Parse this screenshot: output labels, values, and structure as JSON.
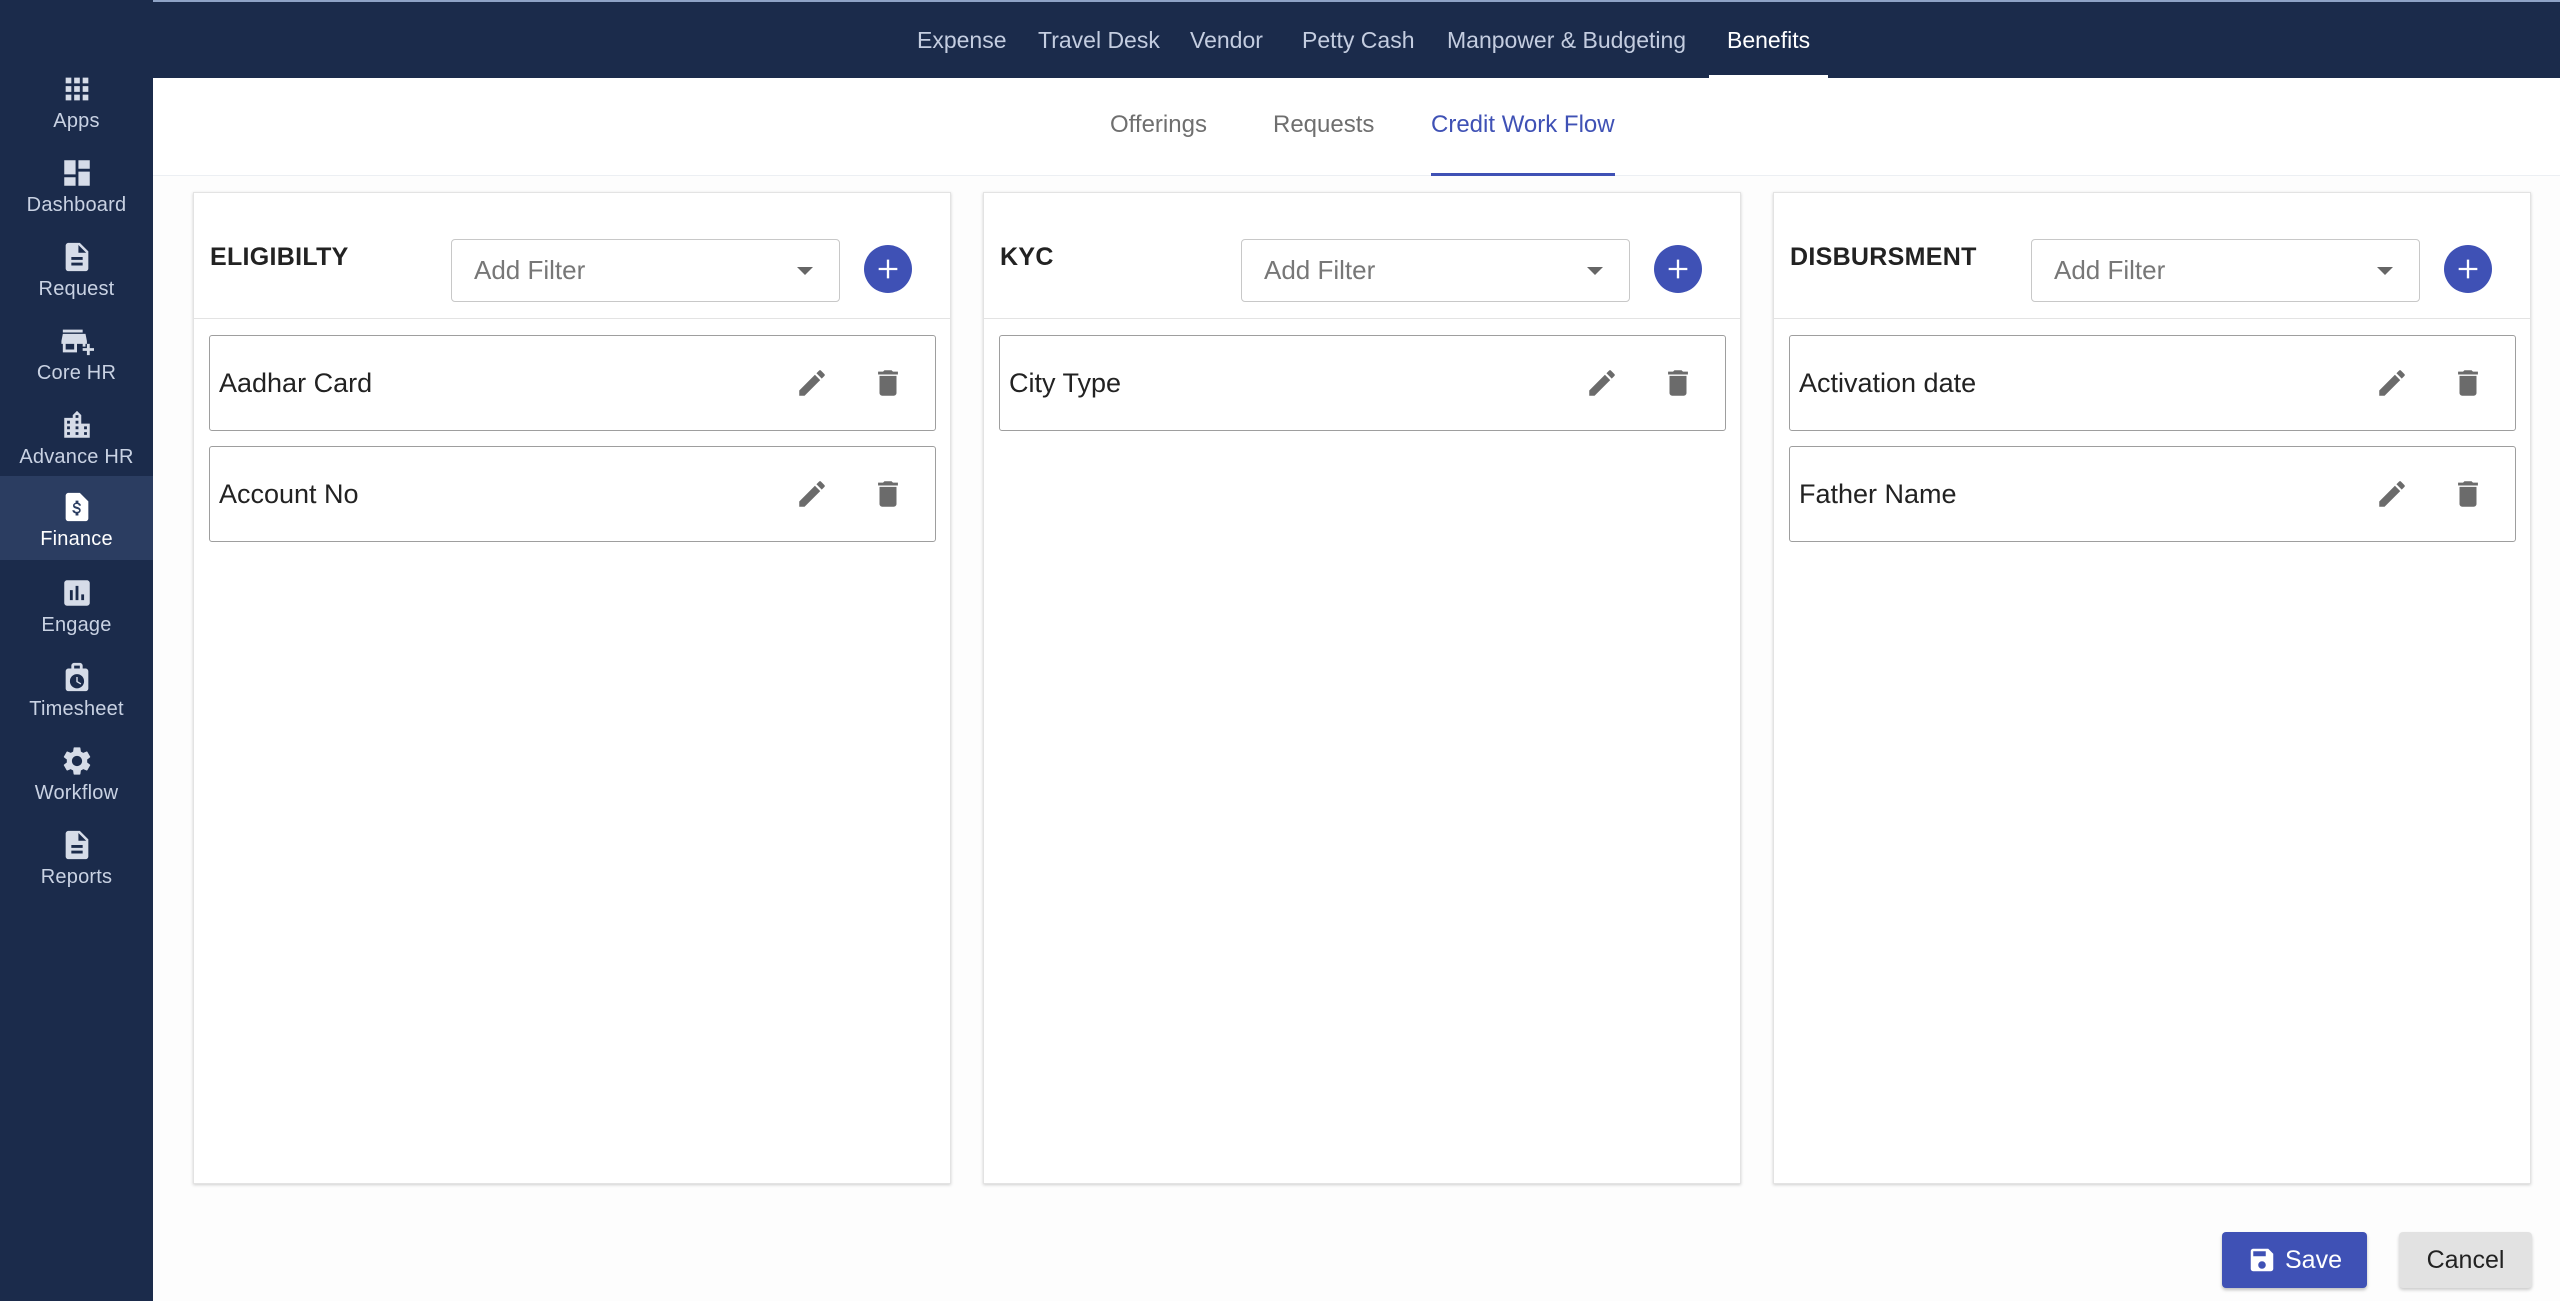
{
  "top_nav": {
    "items": [
      {
        "label": "Expense"
      },
      {
        "label": "Travel Desk"
      },
      {
        "label": "Vendor"
      },
      {
        "label": "Petty Cash"
      },
      {
        "label": "Manpower & Budgeting"
      },
      {
        "label": "Benefits",
        "active": true
      }
    ]
  },
  "sidebar": {
    "items": [
      {
        "label": "Apps",
        "icon": "apps-grid-icon"
      },
      {
        "label": "Dashboard",
        "icon": "dashboard-icon"
      },
      {
        "label": "Request",
        "icon": "document-icon"
      },
      {
        "label": "Core HR",
        "icon": "store-add-icon"
      },
      {
        "label": "Advance HR",
        "icon": "building-icon"
      },
      {
        "label": "Finance",
        "icon": "finance-dollar-icon",
        "active": true
      },
      {
        "label": "Engage",
        "icon": "bar-chart-icon"
      },
      {
        "label": "Timesheet",
        "icon": "clock-bag-icon"
      },
      {
        "label": "Workflow",
        "icon": "gear-icon"
      },
      {
        "label": "Reports",
        "icon": "report-document-icon"
      }
    ]
  },
  "sub_tabs": {
    "items": [
      {
        "label": "Offerings"
      },
      {
        "label": "Requests"
      },
      {
        "label": "Credit Work Flow",
        "active": true
      }
    ]
  },
  "panels": [
    {
      "title": "ELIGIBILTY",
      "filter_placeholder": "Add Filter",
      "fields": [
        {
          "name": "Aadhar Card"
        },
        {
          "name": "Account No"
        }
      ]
    },
    {
      "title": "KYC",
      "filter_placeholder": "Add Filter",
      "fields": [
        {
          "name": "City Type"
        }
      ]
    },
    {
      "title": "DISBURSMENT",
      "filter_placeholder": "Add Filter",
      "fields": [
        {
          "name": "Activation date"
        },
        {
          "name": "Father Name"
        }
      ]
    }
  ],
  "actions": {
    "save_label": "Save",
    "cancel_label": "Cancel"
  },
  "colors": {
    "nav_background": "#1b2b4b",
    "accent": "#3f51b5",
    "cancel_background": "#e2e2e2"
  }
}
